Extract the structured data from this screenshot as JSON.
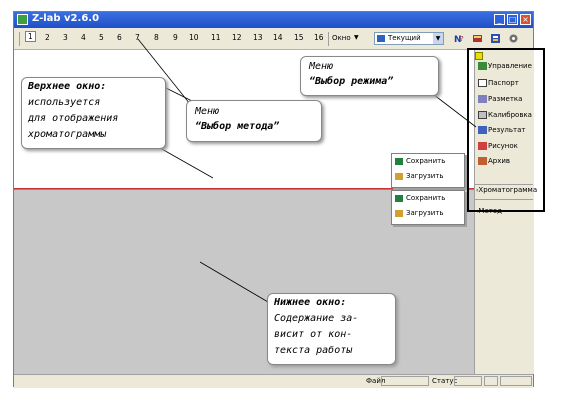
{
  "app": {
    "title": "Z-lab v2.6.0"
  },
  "toolbar": {
    "tabs": [
      "1",
      "2",
      "3",
      "4",
      "5",
      "6",
      "7",
      "8",
      "9",
      "10",
      "11",
      "12",
      "13",
      "14",
      "15",
      "16"
    ],
    "window_label": "Окно",
    "mode_select": "Текущий"
  },
  "right_menu": {
    "items": [
      "Управление",
      "Паспорт",
      "Разметка",
      "Калибровка",
      "Результат",
      "Рисунок",
      "Архив"
    ],
    "chromatogram": "Хроматограмма",
    "method": "Метод"
  },
  "popup_upper": {
    "save": "Сохранить",
    "load": "Загрузить"
  },
  "popup_lower": {
    "save": "Сохранить",
    "load": "Загрузить"
  },
  "status": {
    "file_label": "Файл",
    "status_label": "Статус"
  },
  "callouts": {
    "upper_window": {
      "title": "Верхнее окно:",
      "lines": [
        "используется",
        "для отображения",
        "хроматограммы"
      ]
    },
    "method_menu": {
      "line1": "Меню",
      "line2": "“Выбор метода”"
    },
    "mode_menu": {
      "line1": "Меню",
      "line2": "“Выбор режима”"
    },
    "lower_window": {
      "title": "Нижнее окно:",
      "lines": [
        "Содержание за-",
        "висит от кон-",
        "текста работы"
      ]
    }
  },
  "colors": {
    "title_bar": "#1f4fc8",
    "annotation_frame": "#000000",
    "separator_line": "#cc3333",
    "lower_bg": "#c8c8c8"
  }
}
